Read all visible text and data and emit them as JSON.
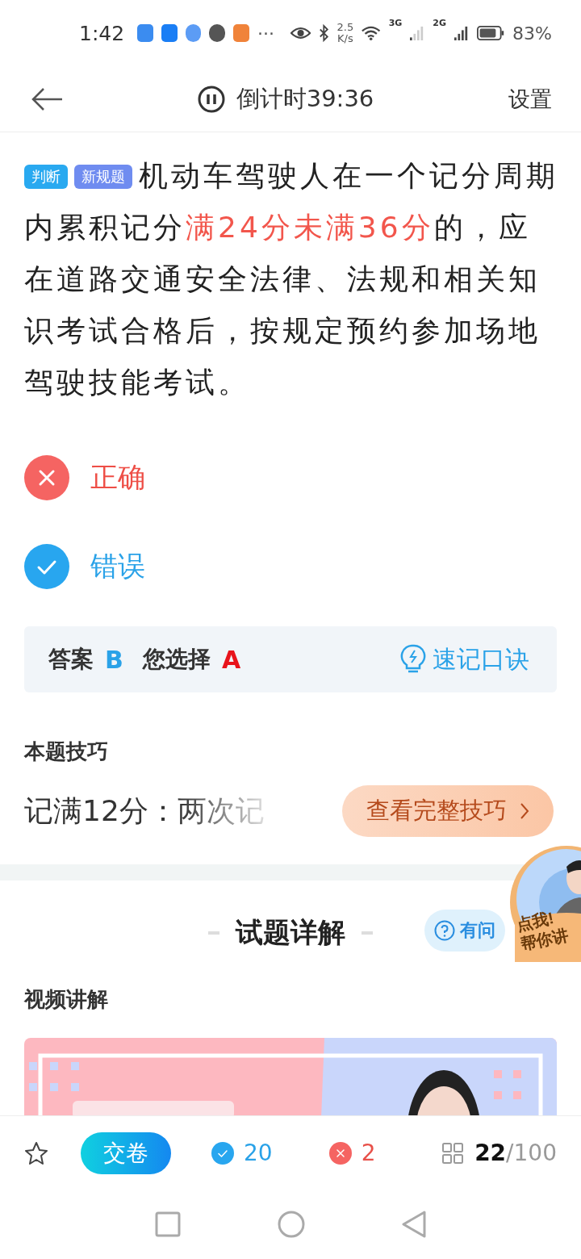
{
  "status_bar": {
    "time": "1:42",
    "net_speed_value": "2.5",
    "net_speed_unit": "K/s",
    "sim_1": "3G",
    "sim_2": "2G",
    "battery": "83%",
    "more": "···"
  },
  "header": {
    "timer": "倒计时39:36",
    "settings": "设置"
  },
  "question": {
    "tags": [
      {
        "label": "判断",
        "color": "#29a9f0"
      },
      {
        "label": "新规题",
        "color": "#6f8cf0"
      }
    ],
    "segments": [
      {
        "text": "机动车驾驶人在一个记分周期内累积记分",
        "highlight": false
      },
      {
        "text": "满24分未满36分",
        "highlight": true
      },
      {
        "text": "的，应在道路交通安全法律、法规和相关知识考试合格后，按规定预约参加场地驾驶技能考试。",
        "highlight": false
      }
    ]
  },
  "options": [
    {
      "label": "正确",
      "kind": "wrong"
    },
    {
      "label": "错误",
      "kind": "right"
    }
  ],
  "answer": {
    "answer_label": "答案",
    "answer": "B",
    "chosen_label": "您选择",
    "chosen": "A",
    "mnemonic": "速记口诀"
  },
  "tip": {
    "title": "本题技巧",
    "text": "记满12分：两次记",
    "more_button": "查看完整技巧"
  },
  "explain": {
    "title": "试题详解",
    "ask": "有问",
    "section": "视频讲解"
  },
  "float_badge": {
    "line_1": "点我!",
    "line_2": "帮你讲"
  },
  "bottom_bar": {
    "submit": "交卷",
    "right_count": "20",
    "wrong_count": "2",
    "current": "22",
    "total": "/100"
  }
}
